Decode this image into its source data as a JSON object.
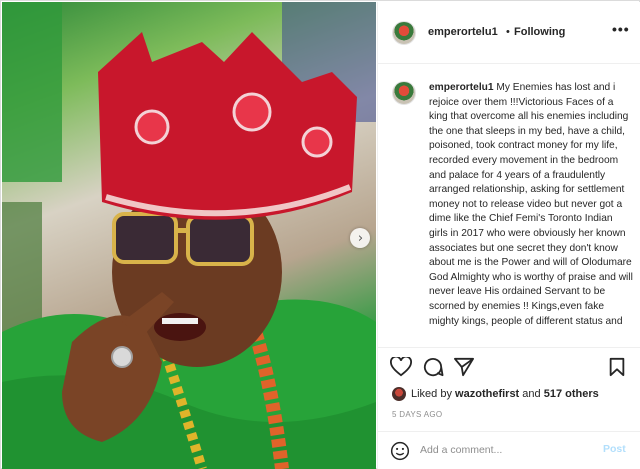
{
  "post": {
    "username": "emperortelu1",
    "separator": "•",
    "follow_status": "Following",
    "more_icon": "more-horizontal-icon"
  },
  "caption": {
    "username": "emperortelu1",
    "text": "My Enemies has lost and i rejoice over them !!!Victorious Faces of a king that overcome all his enemies including the one that sleeps in my bed, have a child, poisoned, took contract money for my life, recorded every movement in the bedroom and palace for 4 years of a fraudulently arranged relationship, asking for settlement money not to release video but never got a dime like the Chief Femi's Toronto Indian girls in 2017 who were obviously her known associates but one secret they don't know about me is the Power and will of Olodumare God Almighty who is worthy of praise and will never leave His ordained Servant to be scorned by enemies !! Kings,even fake mighty kings, people of different status and"
  },
  "actions": {
    "like_icon": "heart-icon",
    "comment_icon": "comment-icon",
    "share_icon": "paper-plane-icon",
    "save_icon": "bookmark-icon"
  },
  "likes": {
    "prefix": "Liked by",
    "liker": "wazothefirst",
    "connector": "and",
    "others": "517 others"
  },
  "timestamp": "5 DAYS AGO",
  "comment": {
    "placeholder": "Add a comment...",
    "post_label": "Post"
  },
  "carousel": {
    "next_glyph": "›"
  }
}
